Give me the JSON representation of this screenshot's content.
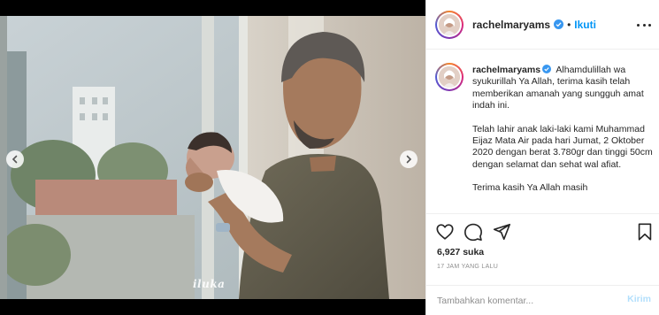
{
  "post": {
    "username": "rachelmaryams",
    "separator": "•",
    "follow_label": "Ikuti",
    "caption_username": "rachelmaryams",
    "caption_paragraphs": [
      "Alhamdulillah wa syukurillah Ya Allah, terima kasih telah memberikan amanah yang sungguh amat indah ini.",
      "Telah lahir anak laki-laki kami Muhammad Eijaz Mata Air pada hari Jumat, 2 Oktober 2020 dengan berat 3.780gr dan tinggi 50cm dengan selamat dan sehat wal afiat.",
      "Terima kasih Ya Allah masih"
    ],
    "likes": "6,927 suka",
    "timestamp": "17 JAM YANG LALU",
    "watermark": "iluka"
  },
  "comment": {
    "placeholder": "Tambahkan komentar...",
    "post_label": "Kirim"
  },
  "icons": {
    "like": "heart-icon",
    "comment": "comment-icon",
    "share": "paper-plane-icon",
    "save": "bookmark-icon",
    "verified": "verified-badge-icon",
    "more": "more-options-icon",
    "prev": "chevron-left-icon",
    "next": "chevron-right-icon"
  },
  "colors": {
    "link": "#0095f6",
    "verified": "#3897f0",
    "post_disabled": "#b2dffc",
    "muted": "#8e8e8e",
    "text": "#262626"
  }
}
